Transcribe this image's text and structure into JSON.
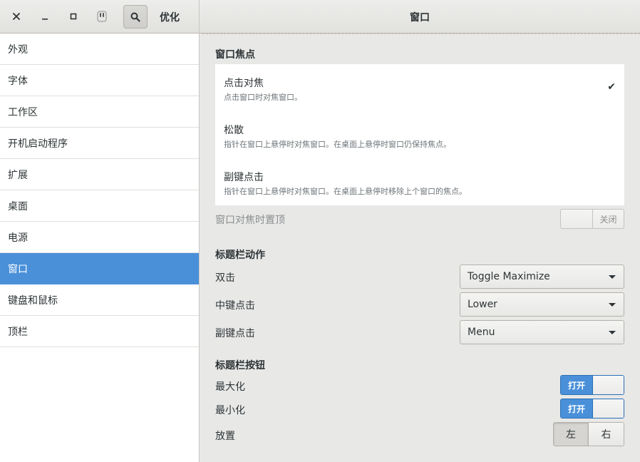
{
  "header": {
    "app_title": "优化",
    "page_title": "窗口",
    "window_buttons": [
      "close-icon",
      "minimize-icon",
      "maximize-icon",
      "app-menu-icon"
    ],
    "search_icon": "search-icon"
  },
  "sidebar": {
    "items": [
      {
        "label": "外观",
        "active": false
      },
      {
        "label": "字体",
        "active": false
      },
      {
        "label": "工作区",
        "active": false
      },
      {
        "label": "开机启动程序",
        "active": false
      },
      {
        "label": "扩展",
        "active": false
      },
      {
        "label": "桌面",
        "active": false
      },
      {
        "label": "电源",
        "active": false
      },
      {
        "label": "窗口",
        "active": true
      },
      {
        "label": "键盘和鼠标",
        "active": false
      },
      {
        "label": "顶栏",
        "active": false
      }
    ]
  },
  "main": {
    "focus_section": {
      "title": "窗口焦点",
      "options": [
        {
          "title": "点击对焦",
          "desc": "点击窗口时对焦窗口。",
          "selected": true
        },
        {
          "title": "松散",
          "desc": "指针在窗口上悬停时对焦窗口。在桌面上悬停时窗口仍保持焦点。",
          "selected": false
        },
        {
          "title": "副键点击",
          "desc": "指针在窗口上悬停时对焦窗口。在桌面上悬停时移除上个窗口的焦点。",
          "selected": false
        }
      ],
      "raise_on_focus": {
        "label": "窗口对焦时置顶",
        "state_label": "关闭"
      }
    },
    "titlebar_actions": {
      "title": "标题栏动作",
      "rows": [
        {
          "label": "双击",
          "value": "Toggle Maximize"
        },
        {
          "label": "中键点击",
          "value": "Lower"
        },
        {
          "label": "副键点击",
          "value": "Menu"
        }
      ]
    },
    "titlebar_buttons": {
      "title": "标题栏按钮",
      "maximize": {
        "label": "最大化",
        "state_label": "打开"
      },
      "minimize": {
        "label": "最小化",
        "state_label": "打开"
      },
      "placement": {
        "label": "放置",
        "left": "左",
        "right": "右",
        "selected": "左"
      }
    }
  },
  "colors": {
    "accent": "#4a90d9",
    "background": "#e8e8e7",
    "sidebar_background": "#ffffff"
  }
}
